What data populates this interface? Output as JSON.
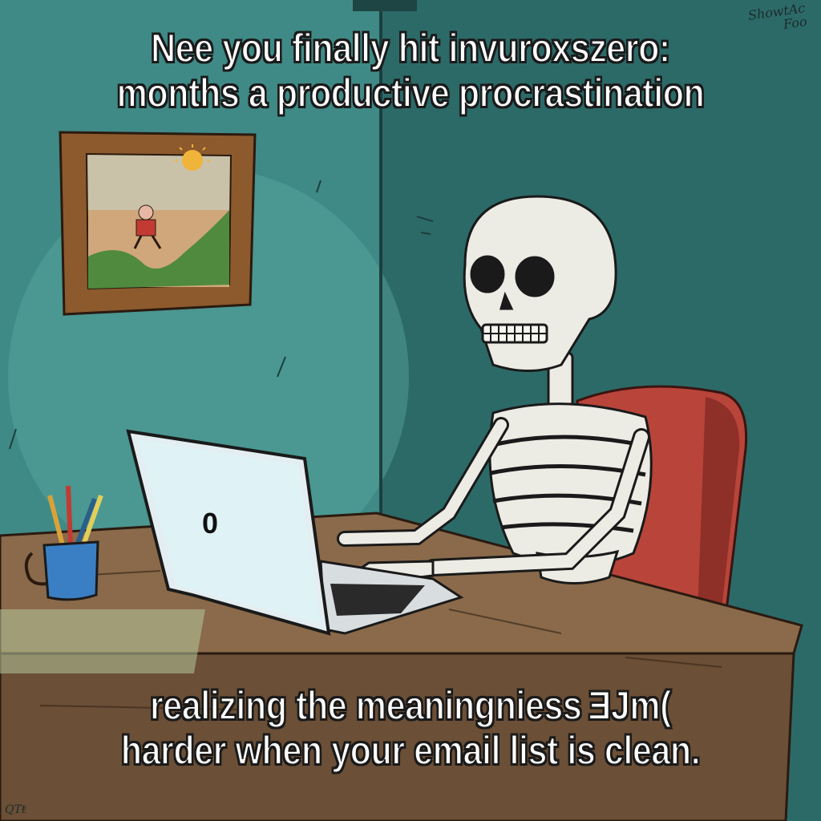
{
  "captions": {
    "top_line1": "Nee you finally hit invuroxszero:",
    "top_line2": "months a productive procrastination",
    "bottom_line1": "realizing the meaningniess ƎJm(",
    "bottom_line2": "harder when your email list is clean."
  },
  "laptop": {
    "screen_text": "0"
  },
  "signature": {
    "top_line1": "ShowtAc",
    "top_line2": "Foo",
    "bottom": "QTŧ"
  },
  "colors": {
    "wall_left": "#3f8a86",
    "wall_right": "#2c6a68",
    "desk": "#8a6a4a",
    "chair": "#b8443a",
    "bone": "#ecebe4",
    "screen": "#dff2f5",
    "mug": "#3a7fc4"
  },
  "icons": [
    "skeleton-figure",
    "laptop-icon",
    "pencil-cup-icon",
    "framed-picture-icon",
    "chair-icon"
  ]
}
